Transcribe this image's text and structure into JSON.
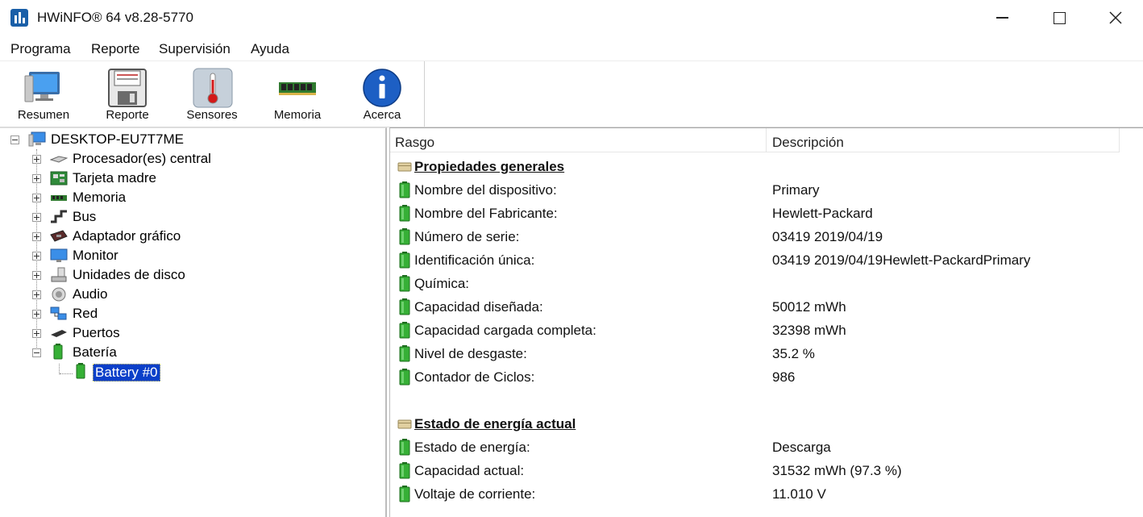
{
  "window": {
    "title": "HWiNFO® 64 v8.28-5770"
  },
  "menu": [
    "Programa",
    "Reporte",
    "Supervisión",
    "Ayuda"
  ],
  "toolbar": [
    {
      "label": "Resumen",
      "icon": "monitor-icon"
    },
    {
      "label": "Reporte",
      "icon": "floppy-disk-icon"
    },
    {
      "label": "Sensores",
      "icon": "thermometer-icon"
    },
    {
      "label": "Memoria",
      "icon": "memory-module-icon"
    },
    {
      "label": "Acerca",
      "icon": "info-icon"
    }
  ],
  "tree": {
    "root": "DESKTOP-EU7T7ME",
    "items": [
      {
        "label": "Procesador(es) central",
        "icon": "cpu-icon",
        "expander": "plus"
      },
      {
        "label": "Tarjeta madre",
        "icon": "motherboard-icon",
        "expander": "plus"
      },
      {
        "label": "Memoria",
        "icon": "memory-icon",
        "expander": "plus"
      },
      {
        "label": "Bus",
        "icon": "bus-icon",
        "expander": "plus"
      },
      {
        "label": "Adaptador gráfico",
        "icon": "graphics-card-icon",
        "expander": "plus"
      },
      {
        "label": "Monitor",
        "icon": "monitor-icon",
        "expander": "plus"
      },
      {
        "label": "Unidades de disco",
        "icon": "disk-drive-icon",
        "expander": "plus"
      },
      {
        "label": "Audio",
        "icon": "speaker-icon",
        "expander": "plus"
      },
      {
        "label": "Red",
        "icon": "network-icon",
        "expander": "plus"
      },
      {
        "label": "Puertos",
        "icon": "port-icon",
        "expander": "plus"
      },
      {
        "label": "Batería",
        "icon": "battery-icon",
        "expander": "minus"
      }
    ],
    "selected": "Battery #0"
  },
  "table": {
    "col_feature": "Rasgo",
    "col_description": "Descripción",
    "section1": "Propiedades generales",
    "rows1": [
      {
        "k": "Nombre del dispositivo:",
        "v": "Primary"
      },
      {
        "k": "Nombre del Fabricante:",
        "v": "Hewlett-Packard"
      },
      {
        "k": "Número de serie:",
        "v": "03419 2019/04/19"
      },
      {
        "k": "Identificación única:",
        "v": "03419 2019/04/19Hewlett-PackardPrimary"
      },
      {
        "k": "Química:",
        "v": ""
      },
      {
        "k": "Capacidad diseñada:",
        "v": "50012 mWh"
      },
      {
        "k": "Capacidad cargada completa:",
        "v": "32398 mWh"
      },
      {
        "k": "Nivel de desgaste:",
        "v": "35.2 %"
      },
      {
        "k": "Contador de Ciclos:",
        "v": "986"
      }
    ],
    "section2": "Estado de energía actual",
    "rows2": [
      {
        "k": "Estado de energía:",
        "v": "Descarga"
      },
      {
        "k": "Capacidad actual:",
        "v": "31532 mWh (97.3 %)"
      },
      {
        "k": "Voltaje de corriente:",
        "v": "11.010 V"
      }
    ]
  },
  "colors": {
    "selection": "#0a3fc9",
    "battery_green": "#2e9e2e"
  }
}
